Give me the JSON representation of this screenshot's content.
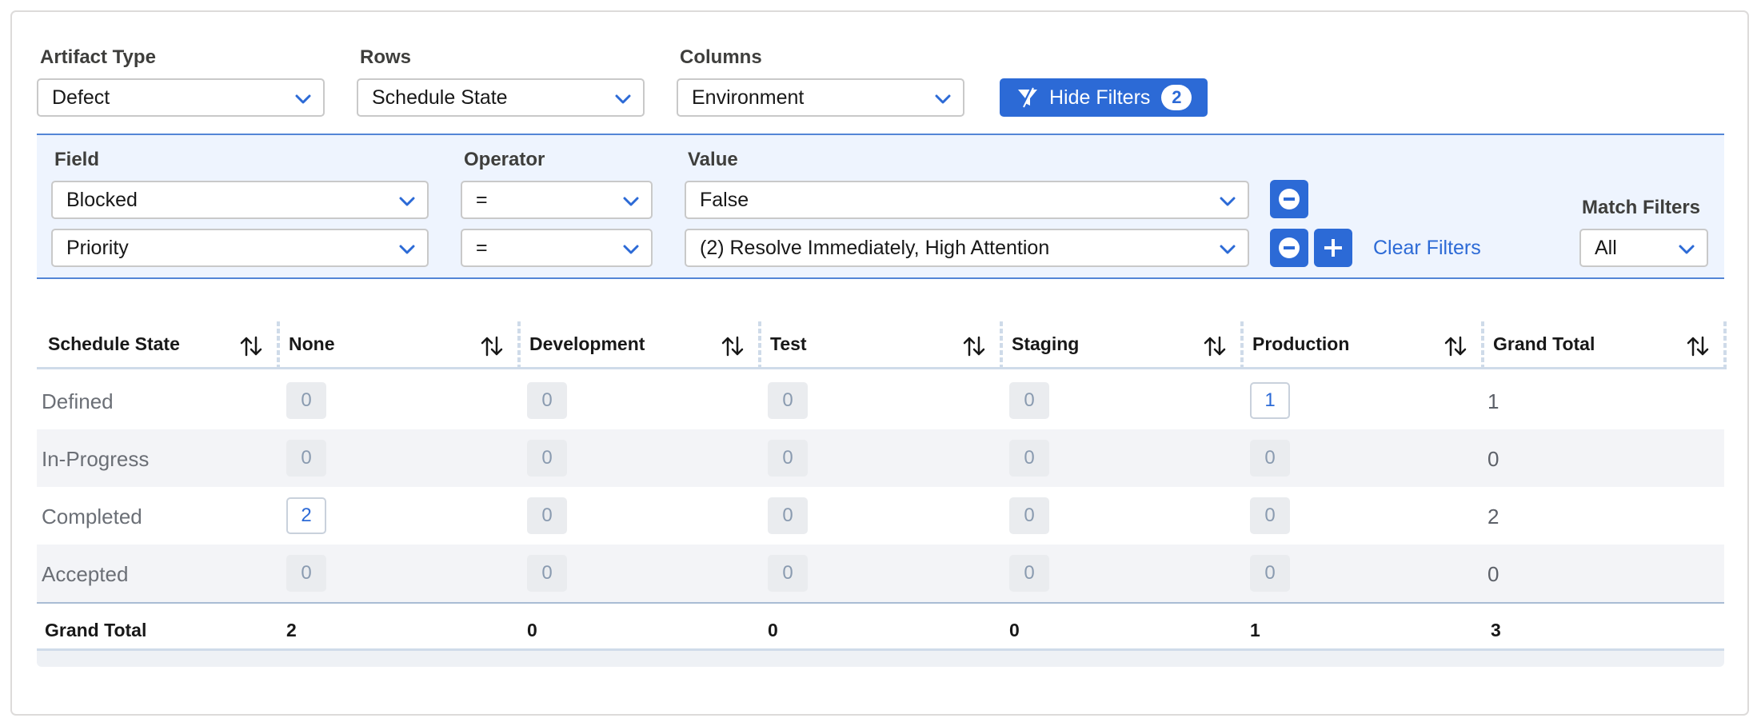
{
  "controls": {
    "artifact_type": {
      "label": "Artifact Type",
      "value": "Defect"
    },
    "rows": {
      "label": "Rows",
      "value": "Schedule State"
    },
    "columns": {
      "label": "Columns",
      "value": "Environment"
    },
    "hide_filters": {
      "label": "Hide Filters",
      "count": "2"
    }
  },
  "filters": {
    "field_label": "Field",
    "operator_label": "Operator",
    "value_label": "Value",
    "rows": [
      {
        "field": "Blocked",
        "operator": "=",
        "value": "False"
      },
      {
        "field": "Priority",
        "operator": "=",
        "value": "(2) Resolve Immediately, High Attention"
      }
    ],
    "clear_label": "Clear Filters",
    "match_label": "Match Filters",
    "match_value": "All"
  },
  "table": {
    "headers": [
      "Schedule State",
      "None",
      "Development",
      "Test",
      "Staging",
      "Production",
      "Grand Total"
    ],
    "rows": [
      {
        "label": "Defined",
        "cells": [
          "0",
          "0",
          "0",
          "0",
          "1"
        ],
        "total": "1"
      },
      {
        "label": "In-Progress",
        "cells": [
          "0",
          "0",
          "0",
          "0",
          "0"
        ],
        "total": "0"
      },
      {
        "label": "Completed",
        "cells": [
          "2",
          "0",
          "0",
          "0",
          "0"
        ],
        "total": "2"
      },
      {
        "label": "Accepted",
        "cells": [
          "0",
          "0",
          "0",
          "0",
          "0"
        ],
        "total": "0"
      }
    ],
    "grand_total": {
      "label": "Grand Total",
      "values": [
        "2",
        "0",
        "0",
        "0",
        "1",
        "3"
      ]
    }
  },
  "colors": {
    "accent": "#2c6ad6",
    "filter_bg": "#eef4fe",
    "stripe": "#f3f4f7"
  },
  "icons": {
    "dropdown": "chevron-down-icon",
    "hide_filters": "filter-off-icon",
    "remove": "minus-circle-icon",
    "add": "plus-icon",
    "sort": "sort-arrows-icon"
  }
}
